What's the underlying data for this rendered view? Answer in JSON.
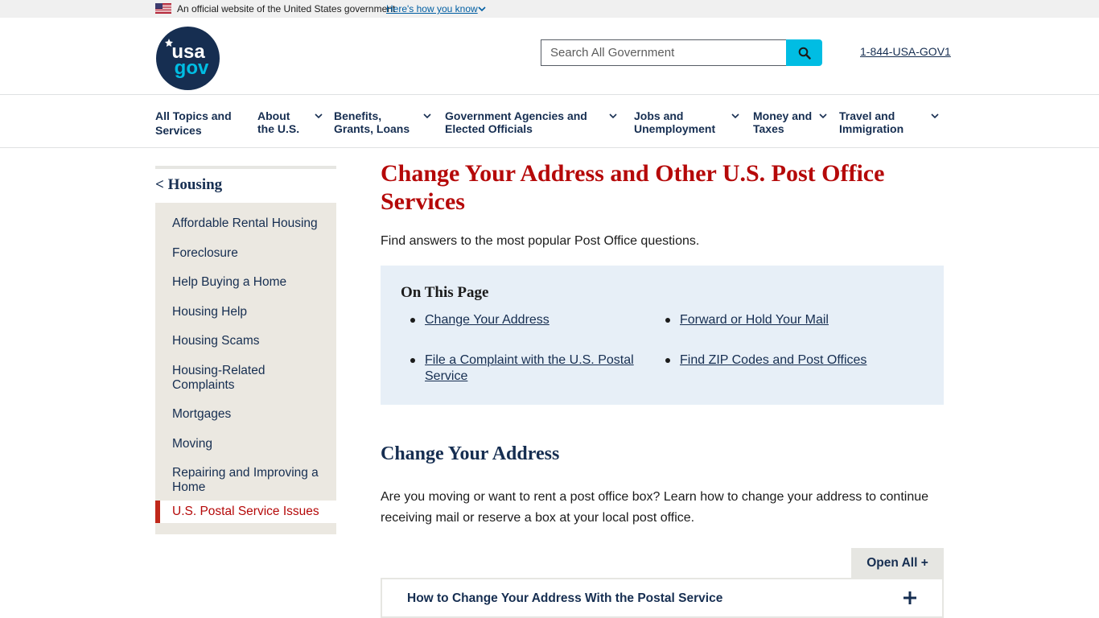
{
  "banner": {
    "official_text": "An official website of the United States government",
    "how_link": "Here's how you know"
  },
  "header": {
    "logo_text_top": "usa",
    "logo_text_bottom": "gov",
    "search_placeholder": "Search All Government",
    "phone": "1-844-USA-GOV1"
  },
  "nav": {
    "items": [
      {
        "line1": "All Topics and",
        "line2": "Services"
      },
      {
        "line1": "About",
        "line2": "the U.S."
      },
      {
        "line1": "Benefits,",
        "line2": "Grants, Loans"
      },
      {
        "line1": "Government Agencies and",
        "line2": "Elected Officials"
      },
      {
        "line1": "Jobs and",
        "line2": "Unemployment"
      },
      {
        "line1": "Money and",
        "line2": "Taxes"
      },
      {
        "line1": "Travel and",
        "line2": "Immigration"
      }
    ]
  },
  "sidebar": {
    "back_label": "< Housing",
    "items": [
      "Affordable Rental Housing",
      "Foreclosure",
      "Help Buying a Home",
      "Housing Help",
      "Housing Scams",
      "Housing-Related Complaints",
      "Mortgages",
      "Moving",
      "Repairing and Improving a Home"
    ],
    "active_item": "U.S. Postal Service Issues"
  },
  "main": {
    "title": "Change Your Address and Other U.S. Post Office Services",
    "intro": "Find answers to the most popular Post Office questions.",
    "on_this_page": {
      "heading": "On This Page",
      "links": [
        "Change Your Address",
        "Forward or Hold Your Mail",
        "File a Complaint with the U.S. Postal Service",
        "Find ZIP Codes and Post Offices"
      ]
    },
    "section_title": "Change Your Address",
    "section_text": "Are you moving or want to rent a post office box? Learn how to change your address to continue receiving mail or reserve a box at your local post office.",
    "open_all": "Open All +",
    "accordion_label": "How to Change Your Address With the Postal Service"
  },
  "colors": {
    "navy": "#162e51",
    "red": "#b50909",
    "search_blue": "#00bde3",
    "otp_bg": "#e7eff7",
    "sidebar_bg": "#ebe8e1"
  }
}
